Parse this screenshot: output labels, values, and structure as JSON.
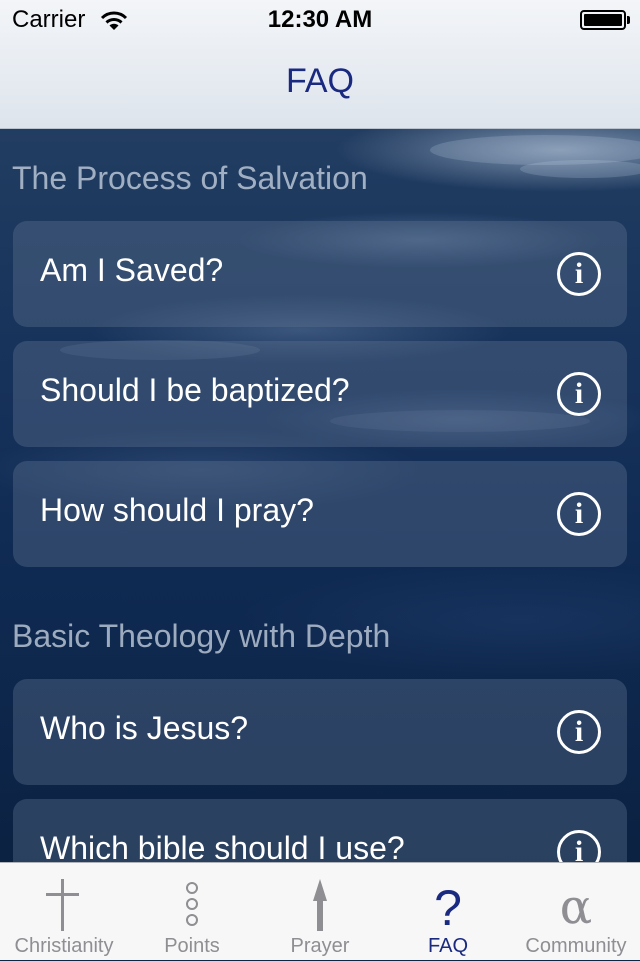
{
  "status_bar": {
    "carrier": "Carrier",
    "time": "12:30 AM"
  },
  "nav": {
    "title": "FAQ"
  },
  "sections": [
    {
      "header": "The Process of Salvation",
      "items": [
        {
          "label": "Am I Saved?",
          "icon": "info-icon"
        },
        {
          "label": "Should I be baptized?",
          "icon": "info-icon"
        },
        {
          "label": "How should I pray?",
          "icon": "info-icon"
        }
      ]
    },
    {
      "header": "Basic Theology with Depth",
      "items": [
        {
          "label": "Who is Jesus?",
          "icon": "info-icon"
        },
        {
          "label": "Which bible should I use?",
          "icon": "info-icon"
        }
      ]
    }
  ],
  "info_glyph": "i",
  "tabs": [
    {
      "label": "Christianity",
      "icon": "cross-icon",
      "active": false
    },
    {
      "label": "Points",
      "icon": "three-dots-icon",
      "active": false
    },
    {
      "label": "Prayer",
      "icon": "arrow-up-icon",
      "active": false
    },
    {
      "label": "FAQ",
      "icon": "question-mark-icon",
      "glyph": "?",
      "active": true
    },
    {
      "label": "Community",
      "icon": "alpha-icon",
      "glyph": "α",
      "active": false
    }
  ],
  "colors": {
    "accent": "#1a2a80",
    "tab_inactive": "#8e8e93",
    "row_text": "#ffffff"
  }
}
